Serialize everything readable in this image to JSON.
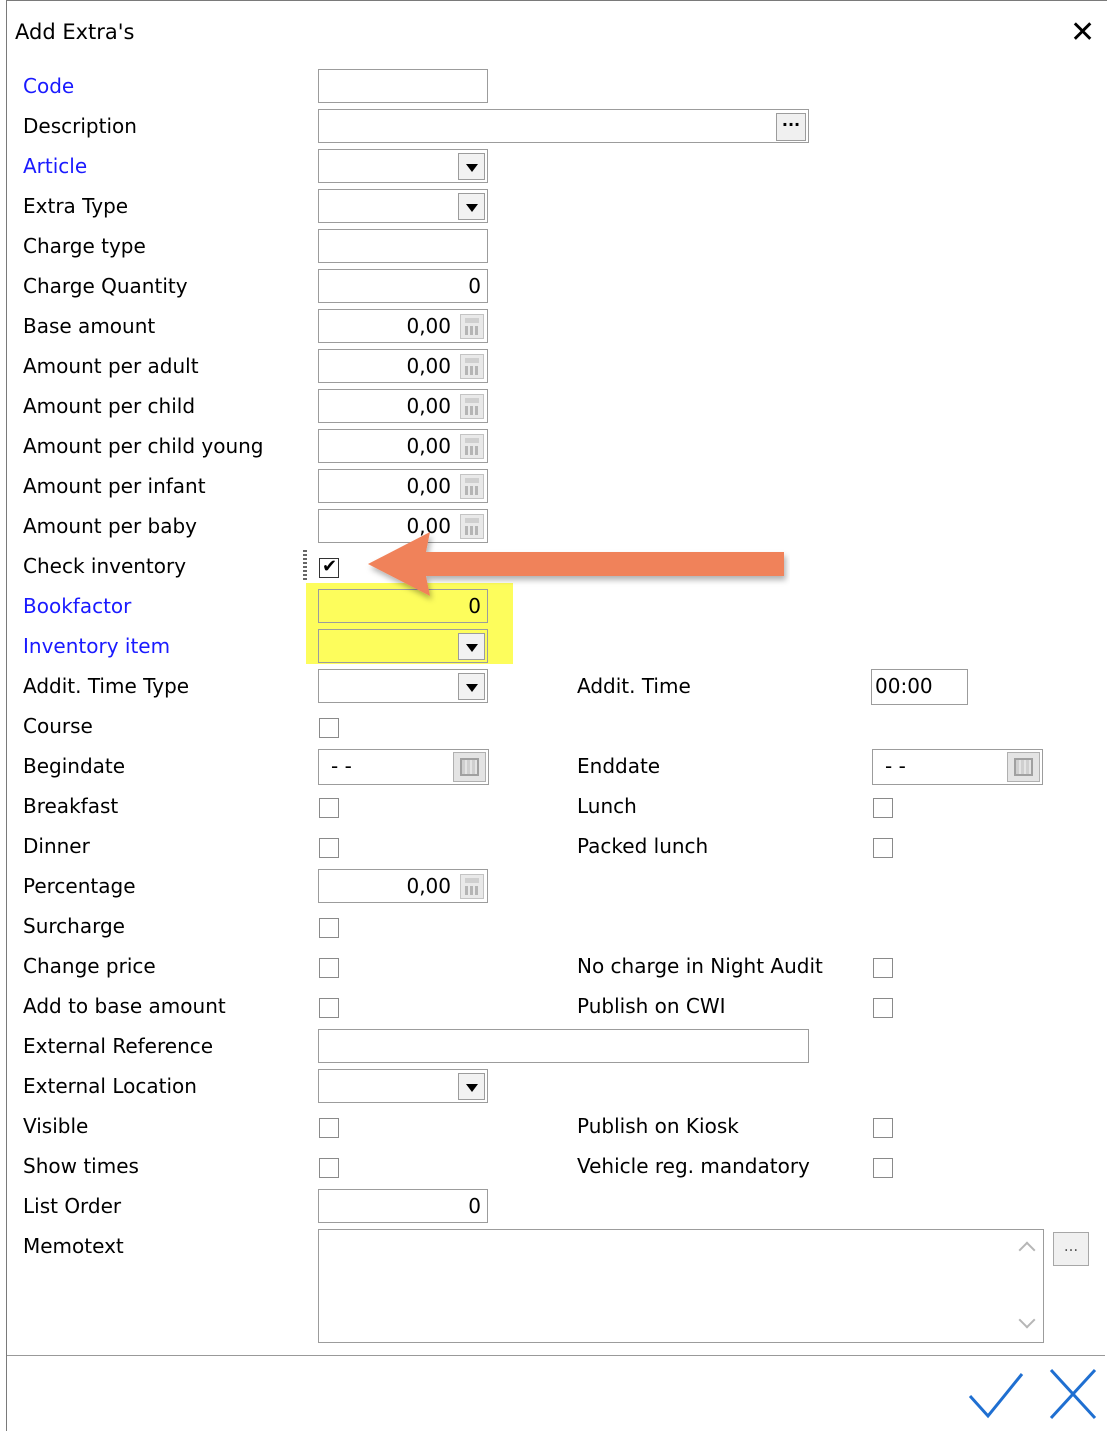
{
  "window": {
    "title": "Add Extra's"
  },
  "labels": {
    "code": "Code",
    "description": "Description",
    "article": "Article",
    "extra_type": "Extra Type",
    "charge_type": "Charge type",
    "charge_quantity": "Charge Quantity",
    "base_amount": "Base amount",
    "amount_per_adult": "Amount per adult",
    "amount_per_child": "Amount per child",
    "amount_per_child_young": "Amount per child young",
    "amount_per_infant": "Amount per infant",
    "amount_per_baby": "Amount per baby",
    "check_inventory": "Check inventory",
    "bookfactor": "Bookfactor",
    "inventory_item": "Inventory item",
    "addit_time_type": "Addit. Time Type",
    "addit_time": "Addit. Time",
    "course": "Course",
    "begindate": "Begindate",
    "enddate": "Enddate",
    "breakfast": "Breakfast",
    "lunch": "Lunch",
    "dinner": "Dinner",
    "packed_lunch": "Packed lunch",
    "percentage": "Percentage",
    "surcharge": "Surcharge",
    "change_price": "Change price",
    "no_charge_night_audit": "No charge in Night Audit",
    "add_to_base_amount": "Add to base amount",
    "publish_on_cwi": "Publish on CWI",
    "external_reference": "External Reference",
    "external_location": "External Location",
    "visible": "Visible",
    "publish_on_kiosk": "Publish on Kiosk",
    "show_times": "Show times",
    "vehicle_reg_mandatory": "Vehicle reg. mandatory",
    "list_order": "List Order",
    "memotext": "Memotext"
  },
  "values": {
    "charge_quantity": "0",
    "base_amount": "0,00",
    "amount_per_adult": "0,00",
    "amount_per_child": "0,00",
    "amount_per_child_young": "0,00",
    "amount_per_infant": "0,00",
    "amount_per_baby": "0,00",
    "bookfactor": "0",
    "addit_time": "00:00",
    "begindate": "- -",
    "enddate": "- -",
    "percentage": "0,00",
    "list_order": "0",
    "description_button": "···",
    "memo_button": "..."
  },
  "checkboxes": {
    "check_inventory": true
  },
  "colors": {
    "required_label": "#1a1aff",
    "highlight": "#fdfd5c",
    "arrow": "#f0825a",
    "action_icons": "#1f6fd1"
  },
  "icons": [
    "close-icon",
    "dropdown-arrow-icon",
    "calculator-icon",
    "calendar-icon",
    "checkmark-icon",
    "confirm-icon",
    "cancel-icon",
    "arrow-annotation"
  ]
}
